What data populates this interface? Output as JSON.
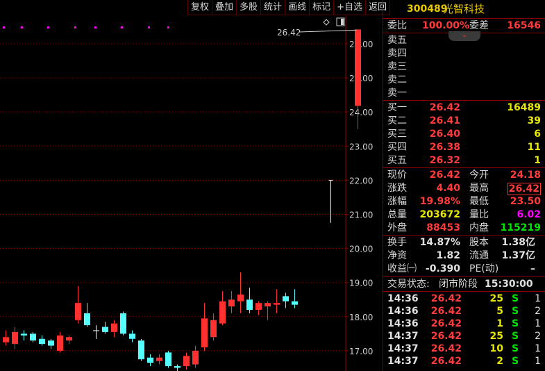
{
  "toolbar": [
    "复权",
    "叠加",
    "多股",
    "统计",
    "画线",
    "标记",
    "+自选",
    "返回"
  ],
  "chart": {
    "ylabels": [
      "26.00",
      "25.00",
      "24.00",
      "23.00",
      "22.00",
      "21.00",
      "20.00",
      "19.00",
      "18.00",
      "17.00"
    ],
    "marker_label": "26.42",
    "colors": {
      "up": "#ff3030",
      "down": "#54ffff",
      "neutral": "#ffffff",
      "grid": "#8a0000",
      "axis": "#d0d0d0"
    },
    "candles": [
      {
        "o": 17.25,
        "c": 17.4,
        "h": 17.6,
        "l": 17.15
      },
      {
        "o": 17.2,
        "c": 17.55,
        "h": 17.7,
        "l": 17.05
      },
      {
        "o": 17.5,
        "c": 17.45,
        "h": 17.6,
        "l": 17.3
      },
      {
        "o": 17.5,
        "c": 17.3,
        "h": 17.55,
        "l": 17.25
      },
      {
        "o": 17.35,
        "c": 17.2,
        "h": 17.45,
        "l": 17.15
      },
      {
        "o": 17.3,
        "c": 17.15,
        "h": 17.35,
        "l": 17.05
      },
      {
        "o": 17.0,
        "c": 17.45,
        "h": 17.55,
        "l": 16.95
      },
      {
        "o": 17.3,
        "c": 17.4,
        "h": 17.45,
        "l": 17.2
      },
      {
        "o": 17.9,
        "c": 18.4,
        "h": 18.9,
        "l": 17.8
      },
      {
        "o": 18.1,
        "c": 17.75,
        "h": 18.4,
        "l": 17.7
      },
      {
        "o": 17.6,
        "c": 17.6,
        "h": 17.75,
        "l": 17.35
      },
      {
        "o": 17.7,
        "c": 17.55,
        "h": 17.85,
        "l": 17.5
      },
      {
        "o": 17.55,
        "c": 17.8,
        "h": 17.9,
        "l": 17.4
      },
      {
        "o": 18.1,
        "c": 17.5,
        "h": 18.15,
        "l": 17.45
      },
      {
        "o": 17.5,
        "c": 17.35,
        "h": 17.6,
        "l": 17.25
      },
      {
        "o": 17.3,
        "c": 16.75,
        "h": 17.35,
        "l": 16.7
      },
      {
        "o": 16.8,
        "c": 16.65,
        "h": 16.9,
        "l": 16.55
      },
      {
        "o": 16.7,
        "c": 16.8,
        "h": 16.9,
        "l": 16.6
      },
      {
        "o": 16.95,
        "c": 16.55,
        "h": 17.0,
        "l": 16.5
      },
      {
        "o": 16.55,
        "c": 16.5,
        "h": 16.6,
        "l": 16.4
      },
      {
        "o": 16.55,
        "c": 16.85,
        "h": 16.95,
        "l": 16.45
      },
      {
        "o": 16.6,
        "c": 17.0,
        "h": 17.15,
        "l": 16.5
      },
      {
        "o": 17.1,
        "c": 17.95,
        "h": 18.4,
        "l": 17.0
      },
      {
        "o": 17.4,
        "c": 17.9,
        "h": 18.1,
        "l": 17.3
      },
      {
        "o": 17.8,
        "c": 18.45,
        "h": 18.75,
        "l": 17.75
      },
      {
        "o": 18.3,
        "c": 18.5,
        "h": 18.75,
        "l": 18.1
      },
      {
        "o": 18.45,
        "c": 18.65,
        "h": 19.3,
        "l": 18.1
      },
      {
        "o": 18.5,
        "c": 18.2,
        "h": 18.85,
        "l": 18.1
      },
      {
        "o": 18.2,
        "c": 18.4,
        "h": 18.45,
        "l": 18.05
      },
      {
        "o": 18.3,
        "c": 18.4,
        "h": 18.45,
        "l": 17.9
      },
      {
        "o": 18.35,
        "c": 18.4,
        "h": 18.8,
        "l": 18.1
      },
      {
        "o": 18.6,
        "c": 18.45,
        "h": 18.7,
        "l": 18.25
      },
      {
        "o": 18.45,
        "c": 18.35,
        "h": 18.8,
        "l": 18.25
      },
      {
        "gap": true
      },
      {
        "gap": true
      },
      {
        "gap": true
      },
      {
        "o": 22.0,
        "c": 22.0,
        "h": 22.0,
        "l": 20.75,
        "neutral": true
      },
      {
        "gap": true
      },
      {
        "gap": true
      },
      {
        "o": 24.18,
        "c": 26.42,
        "h": 26.42,
        "l": 23.5
      }
    ]
  },
  "stock": {
    "code": "300489",
    "name": "光智科技"
  },
  "weibi": {
    "label": "委比",
    "value": "100.00%",
    "label2": "委差",
    "value2": "16546"
  },
  "sells": [
    "卖五",
    "卖四",
    "卖三",
    "卖二",
    "卖一"
  ],
  "buys": [
    {
      "label": "买一",
      "price": "26.42",
      "vol": "16489"
    },
    {
      "label": "买二",
      "price": "26.41",
      "vol": "39"
    },
    {
      "label": "买三",
      "price": "26.40",
      "vol": "6"
    },
    {
      "label": "买四",
      "price": "26.38",
      "vol": "11"
    },
    {
      "label": "买五",
      "price": "26.32",
      "vol": "1"
    }
  ],
  "quote": {
    "xianjia": {
      "label": "现价",
      "value": "26.42"
    },
    "jinkai": {
      "label": "今开",
      "value": "24.18"
    },
    "zhangdie": {
      "label": "涨跌",
      "value": "4.40"
    },
    "zuigao": {
      "label": "最高",
      "value": "26.42"
    },
    "zhangfu": {
      "label": "涨幅",
      "value": "19.98%"
    },
    "zuidi": {
      "label": "最低",
      "value": "23.50"
    },
    "zongliang": {
      "label": "总量",
      "value": "203672"
    },
    "liangbi": {
      "label": "量比",
      "value": "6.02"
    },
    "waipan": {
      "label": "外盘",
      "value": "88453"
    },
    "neipan": {
      "label": "内盘",
      "value": "115219"
    }
  },
  "fund": {
    "huanshou": {
      "label": "换手",
      "value": "14.87%"
    },
    "guben": {
      "label": "股本",
      "value": "1.38亿"
    },
    "jingzi": {
      "label": "净资",
      "value": "1.82"
    },
    "liutong": {
      "label": "流通",
      "value": "1.37亿"
    },
    "shouyi": {
      "label": "收益㈠",
      "value": "-0.390"
    },
    "pe": {
      "label": "PE(动)",
      "value": "–"
    }
  },
  "status": {
    "label": "交易状态:",
    "phase": "闭市阶段",
    "time": "15:30:00"
  },
  "ticks": [
    {
      "time": "14:36",
      "price": "26.42",
      "vol": "25",
      "dir": "S",
      "n": "1"
    },
    {
      "time": "14:36",
      "price": "26.42",
      "vol": "5",
      "dir": "S",
      "n": "2"
    },
    {
      "time": "14:36",
      "price": "26.42",
      "vol": "1",
      "dir": "S",
      "n": "1"
    },
    {
      "time": "14:37",
      "price": "26.42",
      "vol": "25",
      "dir": "S",
      "n": "2"
    },
    {
      "time": "14:37",
      "price": "26.42",
      "vol": "10",
      "dir": "S",
      "n": "1"
    },
    {
      "time": "14:37",
      "price": "26.42",
      "vol": "2",
      "dir": "S",
      "n": "1"
    }
  ]
}
